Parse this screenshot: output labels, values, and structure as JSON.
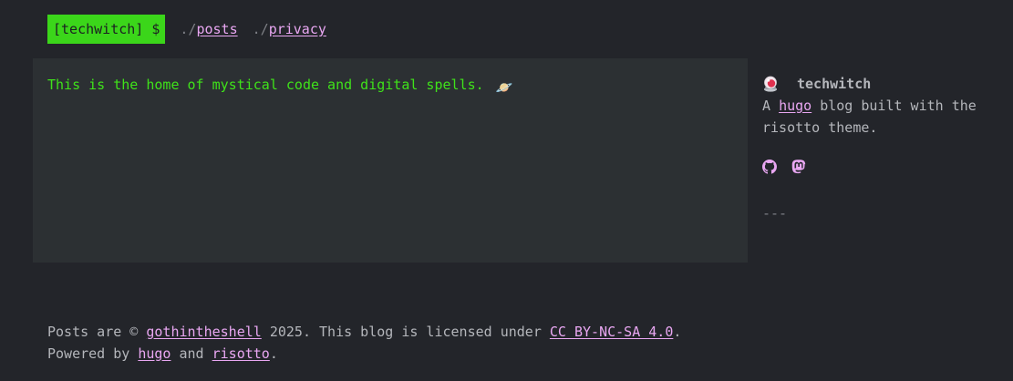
{
  "header": {
    "prompt": "[techwitch] $",
    "nav": [
      {
        "prefix": "./",
        "label": "posts"
      },
      {
        "prefix": "./",
        "label": "privacy"
      }
    ]
  },
  "main": {
    "text": "This is the home of mystical code and digital spells.",
    "emoji": "🪐"
  },
  "sidebar": {
    "avatar_icon": "crystal-ball-icon",
    "site_title": "techwitch",
    "description_prefix": "A",
    "description_link": "hugo",
    "description_suffix": "blog built with the risotto theme.",
    "social_icons": [
      "github-icon",
      "mastodon-icon"
    ],
    "divider": "---"
  },
  "footer": {
    "line1_prefix": "Posts are ©",
    "line1_author": "gothintheshell",
    "line1_middle": "2025. This blog is licensed under",
    "line1_license": "CC BY-NC-SA 4.0",
    "line1_end": ".",
    "line2_prefix": "Powered by",
    "line2_link1": "hugo",
    "line2_and": "and",
    "line2_link2": "risotto",
    "line2_end": "."
  },
  "colors": {
    "background": "#23252a",
    "main_panel": "#2c3033",
    "accent_green": "#3bd61a",
    "link": "#e9a7f2"
  }
}
